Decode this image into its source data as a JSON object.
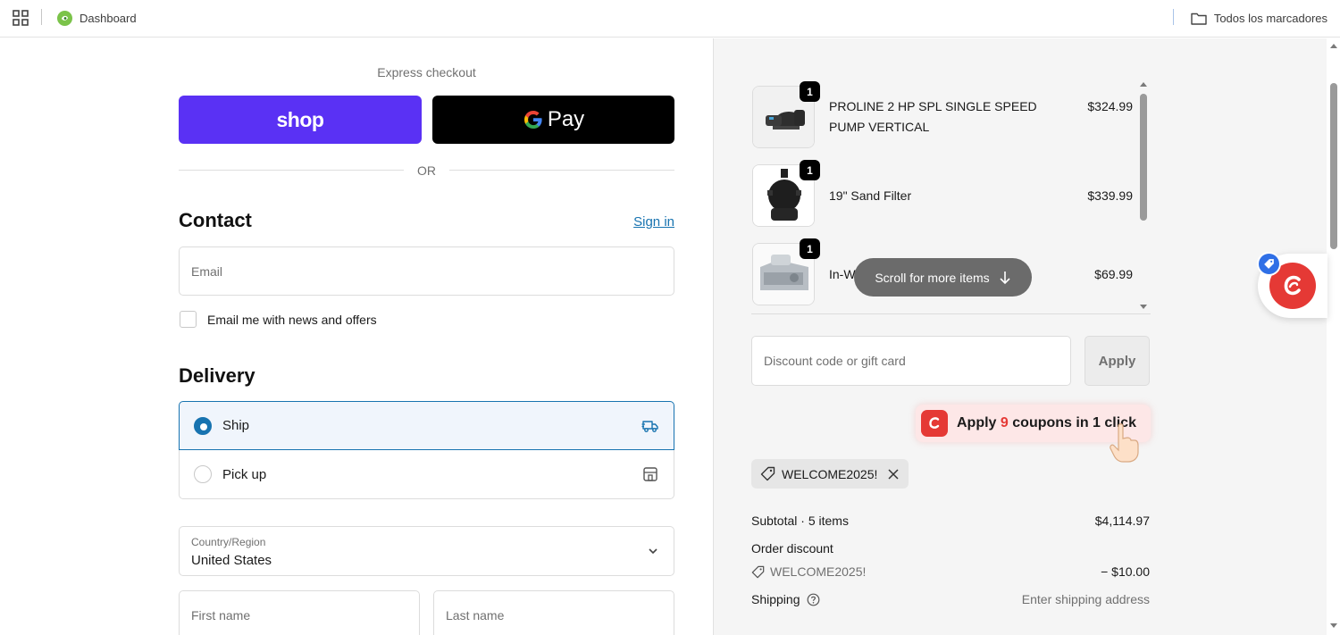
{
  "bookmarks_bar": {
    "dashboard_label": "Dashboard",
    "all_bookmarks_label": "Todos los marcadores"
  },
  "checkout": {
    "express_title": "Express checkout",
    "shop_pay_label": "shop",
    "gpay_label": "Pay",
    "or_divider": "OR",
    "contact": {
      "heading": "Contact",
      "sign_in_link": "Sign in",
      "email_placeholder": "Email",
      "newsletter_label": "Email me with news and offers"
    },
    "delivery": {
      "heading": "Delivery",
      "options": [
        {
          "label": "Ship",
          "selected": true,
          "icon": "truck-icon"
        },
        {
          "label": "Pick up",
          "selected": false,
          "icon": "store-icon"
        }
      ],
      "country_label": "Country/Region",
      "country_value": "United States",
      "first_name_placeholder": "First name",
      "last_name_placeholder": "Last name"
    }
  },
  "order_summary": {
    "items": [
      {
        "quantity": "1",
        "name": "PROLINE 2 HP SPL SINGLE SPEED PUMP VERTICAL",
        "price": "$324.99"
      },
      {
        "quantity": "1",
        "name": "19\" Sand Filter",
        "price": "$339.99"
      },
      {
        "quantity": "1",
        "name": "In-W",
        "price": "$69.99"
      }
    ],
    "scroll_hint": "Scroll for more items",
    "discount_placeholder": "Discount code or gift card",
    "apply_label": "Apply",
    "coupon_prompt": {
      "prefix": "Apply",
      "count": "9",
      "suffix": "coupons in 1 click"
    },
    "applied_code": "WELCOME2025!",
    "subtotal_label": "Subtotal · 5 items",
    "subtotal_value": "$4,114.97",
    "order_discount_label": "Order discount",
    "discount_code": "WELCOME2025!",
    "discount_value": "− $10.00",
    "shipping_label": "Shipping",
    "shipping_value": "Enter shipping address"
  },
  "colors": {
    "shop_pay": "#5a31f4",
    "link": "#1773b0",
    "coupon_brand": "#e53935"
  }
}
